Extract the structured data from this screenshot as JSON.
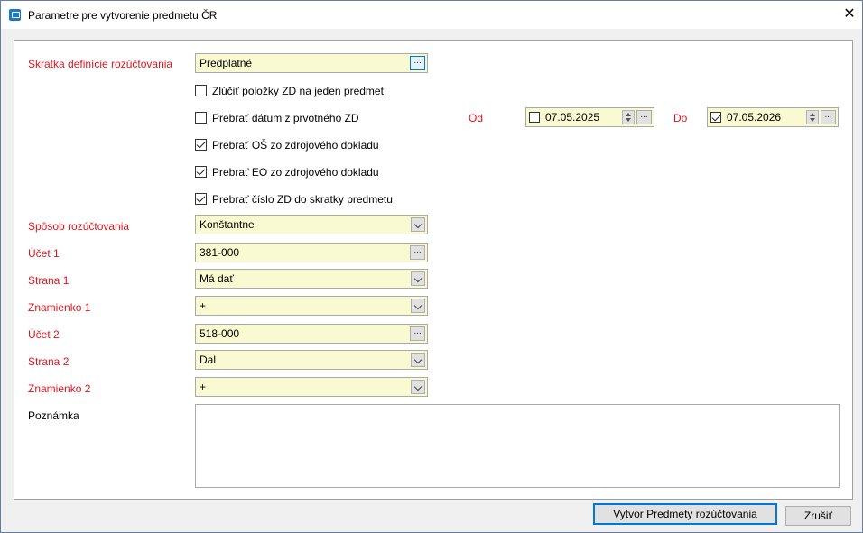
{
  "window": {
    "title": "Parametre pre vytvorenie predmetu ČR"
  },
  "form": {
    "skratka": {
      "label": "Skratka definície rozúčtovania",
      "value": "Predplatné",
      "button": "..."
    },
    "checkboxes": [
      {
        "label": "Zlúčiť položky ZD na jeden predmet",
        "checked": false
      },
      {
        "label": "Prebrať dátum z prvotného ZD",
        "checked": false
      },
      {
        "label": "Prebrať OŠ zo zdrojového dokladu",
        "checked": true
      },
      {
        "label": "Prebrať EO zo zdrojového dokladu",
        "checked": true
      },
      {
        "label": "Prebrať číslo ZD do skratky predmetu",
        "checked": true
      }
    ],
    "date_from": {
      "label": "Od",
      "value": "07.05.2025",
      "checked": false,
      "button": "..."
    },
    "date_to": {
      "label": "Do",
      "value": "07.05.2026",
      "checked": true,
      "button": "..."
    },
    "sposob": {
      "label": "Spôsob rozúčtovania",
      "value": "Konštantne"
    },
    "ucet1": {
      "label": "Účet 1",
      "value": "381-000",
      "button": "..."
    },
    "strana1": {
      "label": "Strana 1",
      "value": "Má dať"
    },
    "znamienko1": {
      "label": "Znamienko 1",
      "value": "+"
    },
    "ucet2": {
      "label": "Účet 2",
      "value": "518-000",
      "button": "..."
    },
    "strana2": {
      "label": "Strana 2",
      "value": "Dal"
    },
    "znamienko2": {
      "label": "Znamienko 2",
      "value": "+"
    },
    "poznamka": {
      "label": "Poznámka",
      "value": ""
    }
  },
  "buttons": {
    "create": "Vytvor Predmety rozúčtovania",
    "cancel": "Zrušiť"
  },
  "colors": {
    "required_label": "#e0141e",
    "field_bg": "#fafad2",
    "accent": "#0078d7"
  }
}
